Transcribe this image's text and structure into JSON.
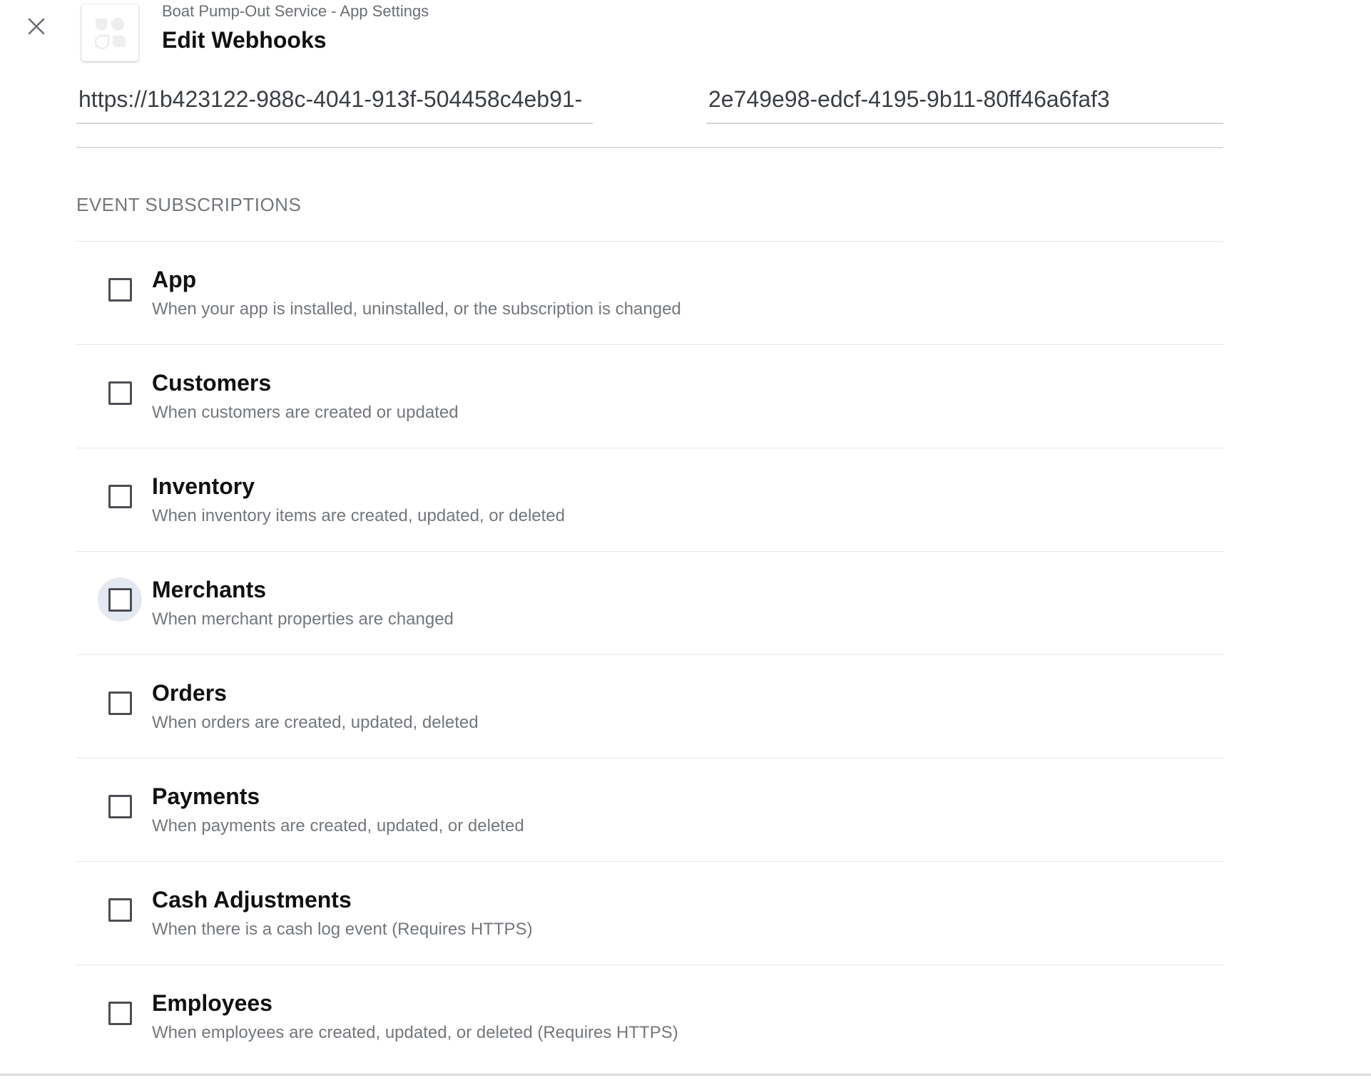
{
  "header": {
    "breadcrumb": "Boat Pump-Out Service - App Settings",
    "title": "Edit Webhooks"
  },
  "form": {
    "callback_url": "https://1b423122-988c-4041-913f-504458c4eb91-",
    "verification_code": "2e749e98-edcf-4195-9b11-80ff46a6faf3"
  },
  "subscriptions": {
    "heading": "EVENT SUBSCRIPTIONS",
    "items": [
      {
        "label": "App",
        "description": "When your app is installed, uninstalled, or the subscription is changed",
        "checked": false
      },
      {
        "label": "Customers",
        "description": "When customers are created or updated",
        "checked": false
      },
      {
        "label": "Inventory",
        "description": "When inventory items are created, updated, or deleted",
        "checked": false
      },
      {
        "label": "Merchants",
        "description": "When merchant properties are changed",
        "checked": false,
        "hovered": true
      },
      {
        "label": "Orders",
        "description": "When orders are created, updated, deleted",
        "checked": false
      },
      {
        "label": "Payments",
        "description": "When payments are created, updated, or deleted",
        "checked": false
      },
      {
        "label": "Cash Adjustments",
        "description": "When there is a cash log event (Requires HTTPS)",
        "checked": false
      },
      {
        "label": "Employees",
        "description": "When employees are created, updated, or deleted (Requires HTTPS)",
        "checked": false
      }
    ]
  },
  "icons": {
    "close": "close-icon",
    "app_logo": "app-placeholder-logo-icon"
  },
  "colors": {
    "title": "#111111",
    "muted_text": "#73777b",
    "checkbox_border": "#4b4f53",
    "hover_highlight": "#e4e8f0",
    "divider": "#e6e7e9"
  }
}
